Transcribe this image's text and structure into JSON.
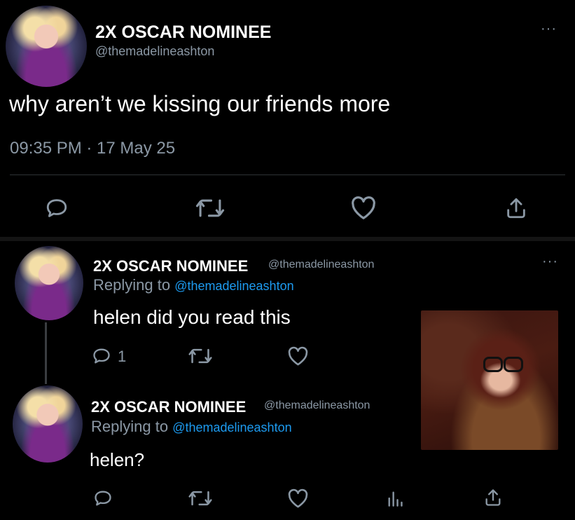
{
  "main_tweet": {
    "display_name": "2X OSCAR NOMINEE",
    "handle": "@themadelineashton",
    "text": "why aren’t we kissing our friends more",
    "timestamp": "09:35 PM · 17 May 25",
    "more_label": "···"
  },
  "replies": [
    {
      "display_name": "2X OSCAR NOMINEE",
      "handle": "@themadelineashton",
      "replying_label": "Replying to",
      "replying_to": "@themadelineashton",
      "text": "helen did you read this",
      "reply_count": "1",
      "more_label": "···"
    },
    {
      "display_name": "2X OSCAR NOMINEE",
      "handle": "@themadelineashton",
      "replying_label": "Replying to",
      "replying_to": "@themadelineashton",
      "text": "helen?"
    }
  ],
  "icons": [
    "reply-icon",
    "retweet-icon",
    "like-icon",
    "share-icon",
    "analytics-icon",
    "more-icon"
  ],
  "colors": {
    "background": "#000000",
    "text": "#ffffff",
    "muted": "#8b98a5",
    "link": "#1d9bf0",
    "divider": "#2f3336"
  }
}
